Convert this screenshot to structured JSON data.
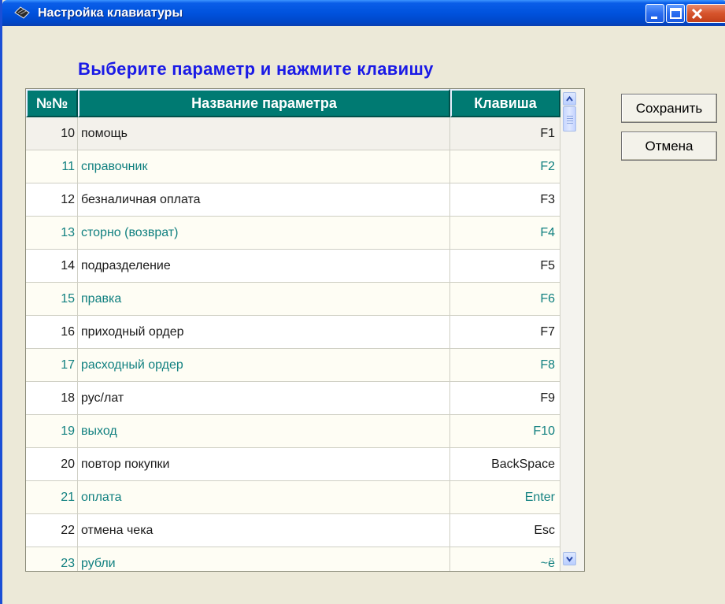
{
  "window": {
    "title": "Настройка клавиатуры"
  },
  "heading": "Выберите параметр и нажмите клавишу",
  "table": {
    "headers": {
      "num": "№№",
      "name": "Название параметра",
      "key": "Клавиша"
    },
    "rows": [
      {
        "num": "10",
        "name": "помощь",
        "key": "F1"
      },
      {
        "num": "11",
        "name": "справочник",
        "key": "F2"
      },
      {
        "num": "12",
        "name": "безналичная оплата",
        "key": "F3"
      },
      {
        "num": "13",
        "name": "сторно (возврат)",
        "key": "F4"
      },
      {
        "num": "14",
        "name": "подразделение",
        "key": "F5"
      },
      {
        "num": "15",
        "name": "правка",
        "key": "F6"
      },
      {
        "num": "16",
        "name": "приходный ордер",
        "key": "F7"
      },
      {
        "num": "17",
        "name": "расходный ордер",
        "key": "F8"
      },
      {
        "num": "18",
        "name": "рус/лат",
        "key": "F9"
      },
      {
        "num": "19",
        "name": "выход",
        "key": "F10"
      },
      {
        "num": "20",
        "name": "повтор покупки",
        "key": "BackSpace"
      },
      {
        "num": "21",
        "name": "оплата",
        "key": "Enter"
      },
      {
        "num": "22",
        "name": "отмена чека",
        "key": "Esc"
      },
      {
        "num": "23",
        "name": "рубли",
        "key": "~ё"
      }
    ]
  },
  "buttons": {
    "save": "Сохранить",
    "cancel": "Отмена"
  },
  "icons": {
    "app": "keyboard-icon",
    "minimize": "minimize-icon",
    "maximize": "maximize-icon",
    "close": "close-icon",
    "scroll_up": "scroll-up-icon",
    "scroll_down": "scroll-down-icon"
  },
  "colors": {
    "titlebar": "#0052dd",
    "heading": "#1a1ae6",
    "header_bg": "#007a72",
    "alt_row_text": "#118080"
  }
}
